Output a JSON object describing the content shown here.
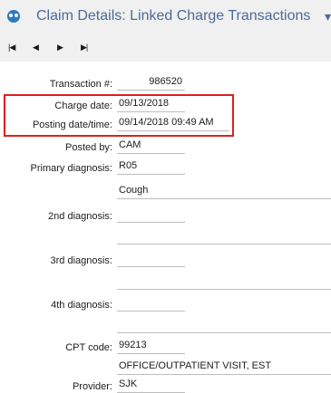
{
  "window": {
    "title": "Claim Details: Linked Charge Transactions",
    "menu_arrow": "▾"
  },
  "nav": {
    "first": "|◀",
    "prev": "◀",
    "next": "▶",
    "last": "▶|"
  },
  "form": {
    "transaction_label": "Transaction #:",
    "transaction_value": "986520",
    "charge_date_label": "Charge date:",
    "charge_date_value": "09/13/2018",
    "posting_label": "Posting date/time:",
    "posting_value": "09/14/2018 09:49 AM",
    "posted_by_label": "Posted by:",
    "posted_by_value": "CAM",
    "primary_dx_label": "Primary diagnosis:",
    "primary_dx_code": "R05",
    "primary_dx_desc": "Cough",
    "dx2_label": "2nd diagnosis:",
    "dx2_code": "",
    "dx2_desc": "",
    "dx3_label": "3rd diagnosis:",
    "dx3_code": "",
    "dx3_desc": "",
    "dx4_label": "4th diagnosis:",
    "dx4_code": "",
    "dx4_desc": "",
    "cpt_label": "CPT code:",
    "cpt_code": "99213",
    "cpt_desc": "OFFICE/OUTPATIENT VISIT, EST",
    "provider_label": "Provider:",
    "provider_value": "SJK"
  },
  "colors": {
    "title_text": "#4a6c9a",
    "highlight_box": "#e01e1e",
    "chrome_bg": "#f0f0f0"
  }
}
